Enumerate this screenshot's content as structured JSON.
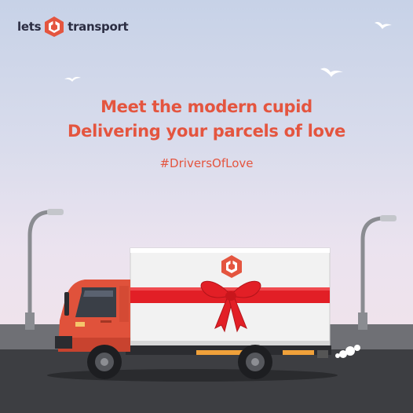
{
  "brand": {
    "name_left": "lets",
    "name_right": "transport",
    "logo_icon": "hexagon-box-logo-icon",
    "accent_color": "#e4553f",
    "text_color": "#2b2d42"
  },
  "headline": {
    "line1": "Meet the modern cupid",
    "line2": "Delivering your parcels of love"
  },
  "hashtag": "#DriversOfLove",
  "scene": {
    "vehicle": "delivery-truck",
    "cab_color": "#e0523b",
    "cargo_color": "#f2f2f2",
    "ribbon_color": "#e21f26"
  }
}
